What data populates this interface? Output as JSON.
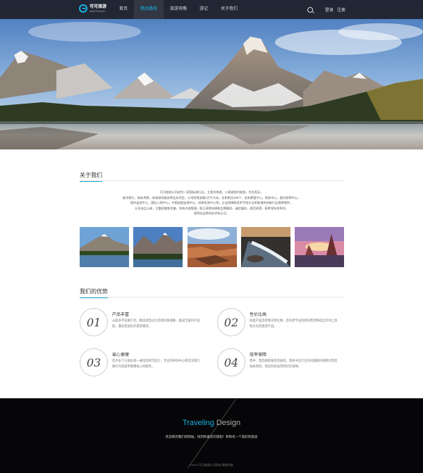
{
  "brand": {
    "name_cn": "可可旅游",
    "name_en": "kekeTourism"
  },
  "nav": {
    "items": [
      {
        "label": "首页"
      },
      {
        "label": "精品路线"
      },
      {
        "label": "旅游攻略"
      },
      {
        "label": "游记"
      },
      {
        "label": "关于我们"
      }
    ],
    "active_index": 1,
    "login": "登录",
    "register": "注册"
  },
  "colors": {
    "accent": "#16b0e0",
    "header_bg": "#1e2028",
    "footer_bg": "#060608"
  },
  "about": {
    "title": "关于我们",
    "lines": [
      "可可旅游公司成为一家国际旅行社，主营内地游，入境游国内旅游，代办签证。",
      "被学旅行，商务考察，本旅游导服务等业务项目，公司经营游客4万平方米，在职职员100个，设有票管中心，财务中心，国内游等中心，",
      "国内出游中心，国际入境中心，中国出国业绩中心，研修信息中心等，企业保障和技术手段方法采取请持技能行业保障提供。",
      "公司成立以来，注重质量和信誉，领先内部管理，取已获得成绩和品牌服务，诚信服务，规范经营，获得领导关系的，",
      "获得社会界的好评和认可。"
    ]
  },
  "advantages": {
    "title": "我们的优势",
    "items": [
      {
        "num": "01",
        "title": "产品丰富",
        "desc": "从超多平设旅行社，精选高性价比高而优质线路，能成丰富的产品链，满足您国内外旅游需求。"
      },
      {
        "num": "02",
        "title": "性价比高",
        "desc": "同类产品选择我司更实惠，还有更专业的顾问帮您精选出市场上高性价比的旅游产品。"
      },
      {
        "num": "03",
        "title": "省心便捷",
        "desc": "您点击下方鼠标或一通电话即可出行，专业的呼叫中心和首深旅行顾问为您提供便捷省心的服务。"
      },
      {
        "num": "04",
        "title": "效率保障",
        "desc": "售中、售后跟踪服务及质检，旅途中出行任何问题顾问随我们帮您准收到找，受您的权益得到切实保障。"
      }
    ]
  },
  "footer": {
    "title_a": "Traveling",
    "title_b": "Design",
    "tagline": "欢迎来到我们的网站，找到你喜欢的旅程！和你有一个美好的旅途",
    "copyright": "©2019 可可旅游公司网站 版权所有"
  },
  "icons": {
    "search": "search-icon",
    "logo": "logo-icon"
  }
}
